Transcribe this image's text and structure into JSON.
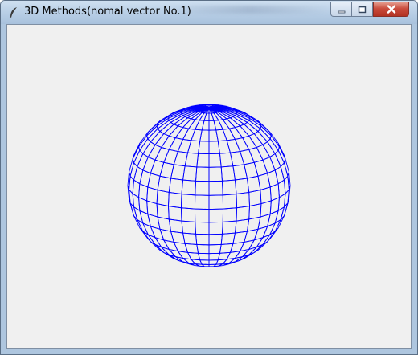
{
  "window": {
    "title": "3D Methods(nomal vector No.1)",
    "app_icon": "feather-icon",
    "controls": {
      "minimize_icon": "minimize-icon",
      "maximize_icon": "maximize-icon",
      "close_icon": "close-icon"
    }
  },
  "canvas": {
    "background": "#f0f0f0",
    "wireframe": {
      "shape": "sphere",
      "line_color": "#0000ff",
      "latitude_bands": 18,
      "longitude_lines": 36,
      "pole_tilt_deg": 17
    }
  }
}
